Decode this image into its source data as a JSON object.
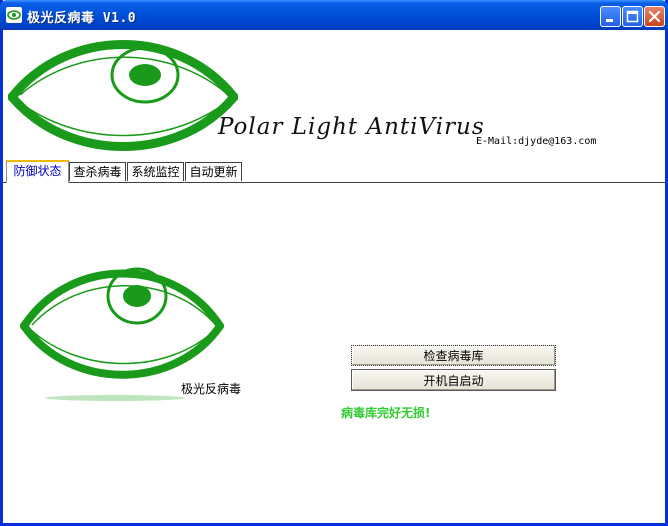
{
  "window": {
    "title": "极光反病毒 V1.0",
    "title_color": "#ffffff",
    "titlebar_color": "#0050d8"
  },
  "header": {
    "brand": "Polar Light AntiVirus",
    "email": "E-Mail:djyde@163.com",
    "logo_icon": "green-eye-icon",
    "logo_color": "#1a9a1a"
  },
  "tabs": [
    {
      "label": "防御状态",
      "active": true
    },
    {
      "label": "查杀病毒",
      "active": false
    },
    {
      "label": "系统监控",
      "active": false
    },
    {
      "label": "自动更新",
      "active": false
    }
  ],
  "panel": {
    "logo_caption": "极光反病毒",
    "check_button": "检查病毒库",
    "autostart_button": "开机自启动",
    "status_text": "病毒库完好无损!",
    "status_color": "#33cc33"
  }
}
